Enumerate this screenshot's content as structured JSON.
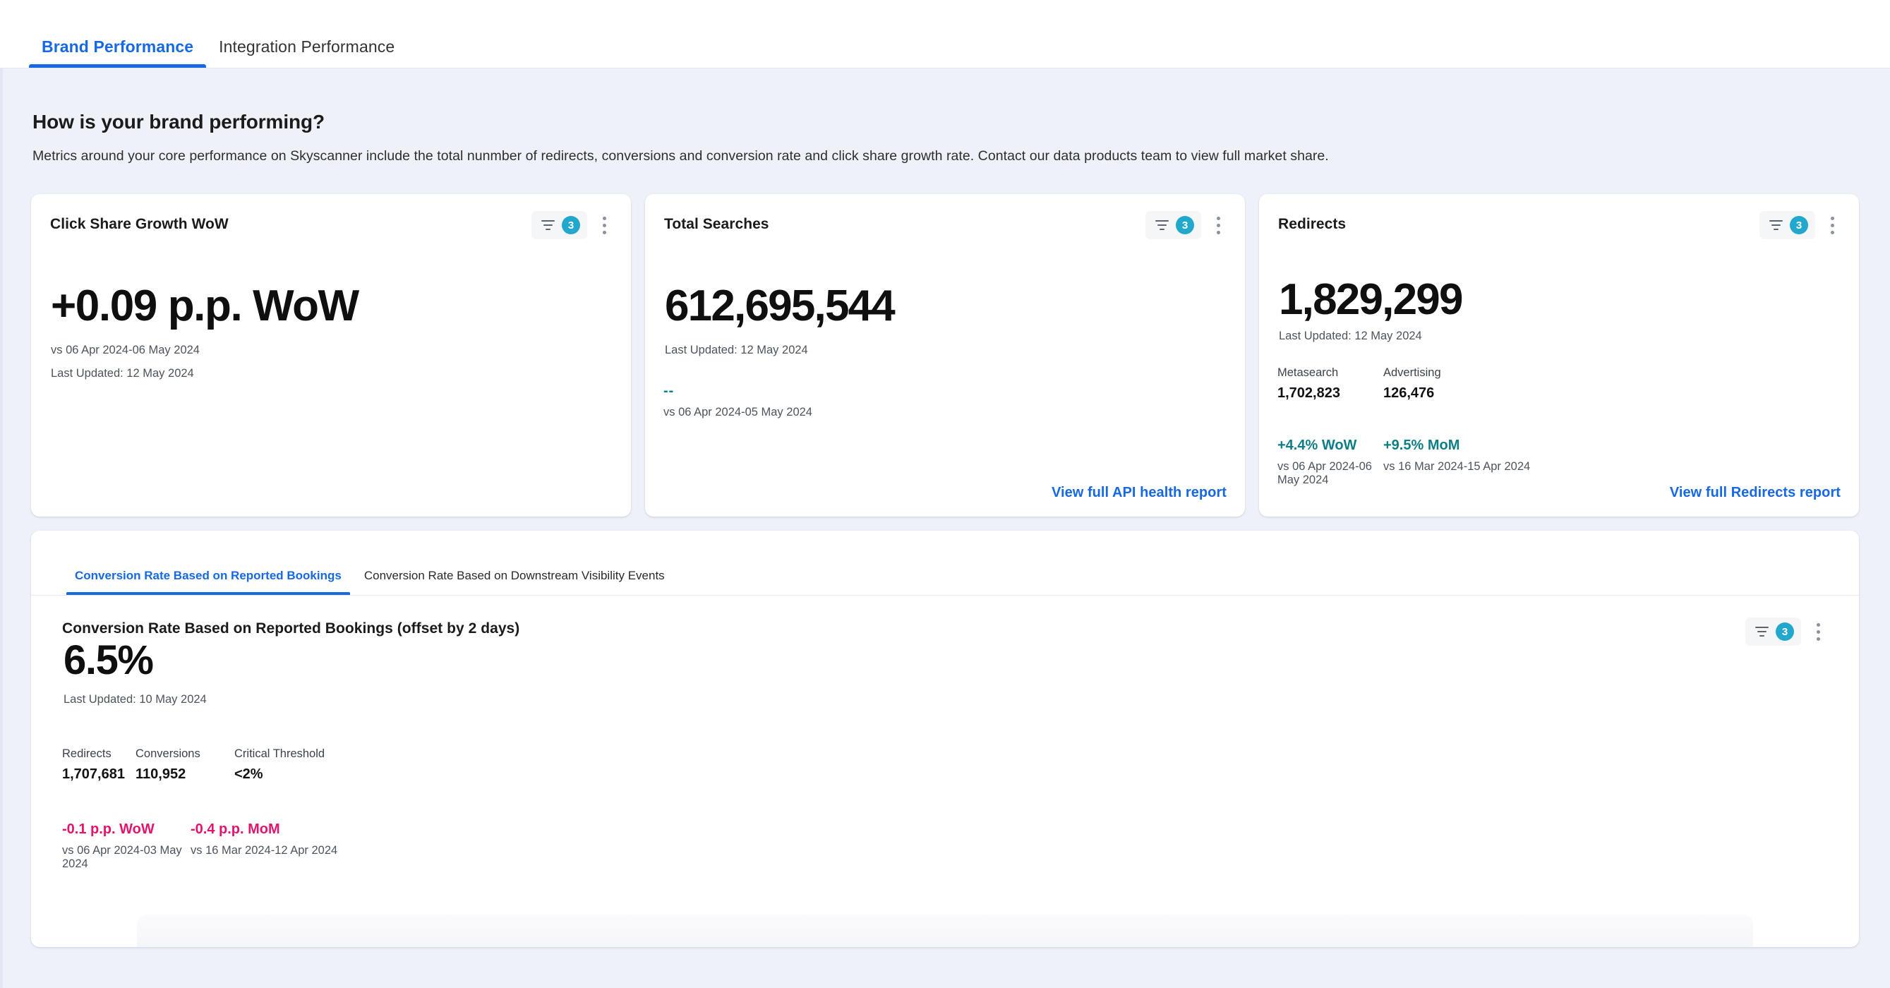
{
  "topbar": {
    "tabs": [
      {
        "label": "Brand Performance",
        "active": true
      },
      {
        "label": "Integration Performance",
        "active": false
      }
    ]
  },
  "section": {
    "title": "How is your brand performing?",
    "subtitle": "Metrics around your core performance on Skyscanner include the total nunmber of redirects, conversions and conversion rate and click share growth rate. Contact our data products team to view full market share."
  },
  "colors": {
    "accent_blue": "#1668e3",
    "badge_cyan": "#21a8cc",
    "positive_teal": "#0e7e86",
    "negative_pink": "#e4136c",
    "page_bg": "#eef1f8"
  },
  "cards": [
    {
      "title": "Click Share Growth WoW",
      "filter_badge": "3",
      "value": "+0.09 p.p. WoW",
      "meta_1": "vs 06 Apr 2024-06 May 2024",
      "meta_2": "Last Updated: 12 May 2024"
    },
    {
      "title": "Total Searches",
      "filter_badge": "3",
      "value": "612,695,544",
      "meta_1": "Last Updated: 12 May 2024",
      "delta_value": "--",
      "delta_meta": "vs 06 Apr 2024-05 May 2024",
      "link": "View full API health report"
    },
    {
      "title": "Redirects",
      "filter_badge": "3",
      "value": "1,829,299",
      "meta_1": "Last Updated: 12 May 2024",
      "sub_metrics": [
        {
          "label": "Metasearch",
          "value": "1,702,823"
        },
        {
          "label": "Advertising",
          "value": "126,476"
        }
      ],
      "deltas": [
        {
          "value": "+4.4% WoW",
          "meta": "vs 06 Apr 2024-06 May 2024"
        },
        {
          "value": "+9.5% MoM",
          "meta": "vs 16 Mar 2024-15 Apr 2024"
        }
      ],
      "link": "View full Redirects report"
    }
  ],
  "conversion_panel": {
    "tabs": [
      {
        "label": "Conversion Rate Based on Reported Bookings",
        "active": true
      },
      {
        "label": "Conversion Rate Based on Downstream Visibility Events",
        "active": false
      }
    ],
    "title": "Conversion Rate Based on Reported Bookings (offset by 2 days)",
    "filter_badge": "3",
    "value": "6.5%",
    "meta_1": "Last Updated: 10 May 2024",
    "sub_metrics": [
      {
        "label": "Redirects",
        "value": "1,707,681"
      },
      {
        "label": "Conversions",
        "value": "110,952"
      },
      {
        "label": "Critical Threshold",
        "value": "<2%"
      }
    ],
    "deltas": [
      {
        "value": "-0.1 p.p. WoW",
        "meta": "vs 06 Apr 2024-03 May 2024"
      },
      {
        "value": "-0.4 p.p. MoM",
        "meta": "vs 16 Mar 2024-12 Apr 2024"
      }
    ]
  }
}
